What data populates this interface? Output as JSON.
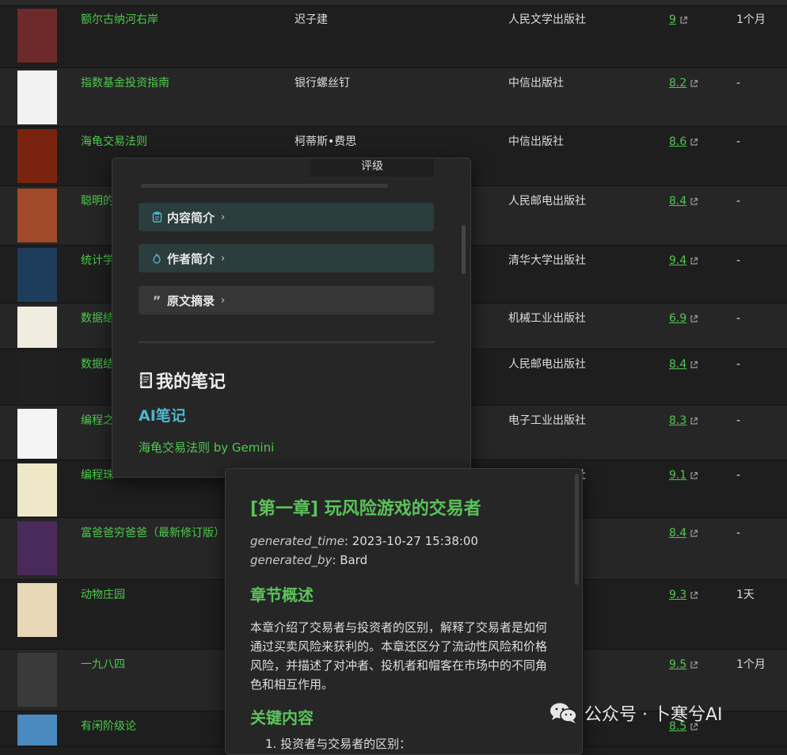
{
  "books": [
    {
      "title": "额尔古纳河右岸",
      "author": "迟子建",
      "publisher": "人民文学出版社",
      "rating": "9",
      "time": "1个月",
      "cover": "#6e2a2a"
    },
    {
      "title": "指数基金投资指南",
      "author": "银行螺丝钉",
      "publisher": "中信出版社",
      "rating": "8.2",
      "time": "-",
      "cover": "#f2f2f2"
    },
    {
      "title": "海龟交易法则",
      "author": "柯蒂斯•费思",
      "publisher": "中信出版社",
      "rating": "8.6",
      "time": "-",
      "cover": "#7a2410"
    },
    {
      "title": "聪明的",
      "author": "",
      "publisher": "人民邮电出版社",
      "rating": "8.4",
      "time": "-",
      "cover": "#a04a2a"
    },
    {
      "title": "统计学",
      "author": "",
      "publisher": "清华大学出版社",
      "rating": "9.4",
      "time": "-",
      "cover": "#1e3d5c"
    },
    {
      "title": "数据结",
      "author": "",
      "publisher": "机械工业出版社",
      "rating": "6.9",
      "time": "-",
      "cover": "#f0ece0"
    },
    {
      "title": "数据结",
      "author": "",
      "publisher": "人民邮电出版社",
      "rating": "8.4",
      "time": "-",
      "cover": "#202020"
    },
    {
      "title": "编程之",
      "author": "",
      "publisher": "电子工业出版社",
      "rating": "8.3",
      "time": "-",
      "cover": "#f4f4f4"
    },
    {
      "title": "编程珠",
      "author": "",
      "publisher": "人民邮电出版社",
      "rating": "9.1",
      "time": "-",
      "cover": "#efe8c8"
    },
    {
      "title": "富爸爸穷爸爸（最新修订版）",
      "author": "",
      "publisher": "",
      "rating": "8.4",
      "time": "-",
      "cover": "#4a2a5a"
    },
    {
      "title": "动物庄园",
      "author": "",
      "publisher": "",
      "rating": "9.3",
      "time": "1天",
      "cover": "#e8d8b8"
    },
    {
      "title": "一九八四",
      "author": "",
      "publisher": "",
      "rating": "9.5",
      "time": "1个月",
      "cover": "#3a3a3a"
    },
    {
      "title": "有闲阶级论",
      "author": "",
      "publisher": "",
      "rating": "8.5",
      "time": "",
      "cover": "#4a8ac0"
    }
  ],
  "popover1": {
    "header": "评级",
    "callout_intro": "内容简介",
    "callout_author": "作者简介",
    "callout_quote": "原文摘录",
    "notes_heading": "我的笔记",
    "ai_heading": "AI笔记",
    "ai_link": "海龟交易法则 by Gemini"
  },
  "popover2": {
    "chapter_title": "[第一章] 玩风险游戏的交易者",
    "meta1_key": "generated_time",
    "meta1_val": ": 2023-10-27 15:38:00",
    "meta2_key": "generated_by",
    "meta2_val": ": Bard",
    "summary_heading": "章节概述",
    "summary_text": "本章介绍了交易者与投资者的区别，解释了交易者是如何通过买卖风险来获利的。本章还区分了流动性风险和价格风险，并描述了对冲者、投机者和帽客在市场中的不同角色和相互作用。",
    "key_heading": "关键内容",
    "list_item_1": "1.  投资者与交易者的区别："
  },
  "watermark": "公众号 · 卜寒兮AI",
  "colors": {
    "accent_green": "#4ec94e",
    "accent_teal": "#4fb6c9"
  }
}
